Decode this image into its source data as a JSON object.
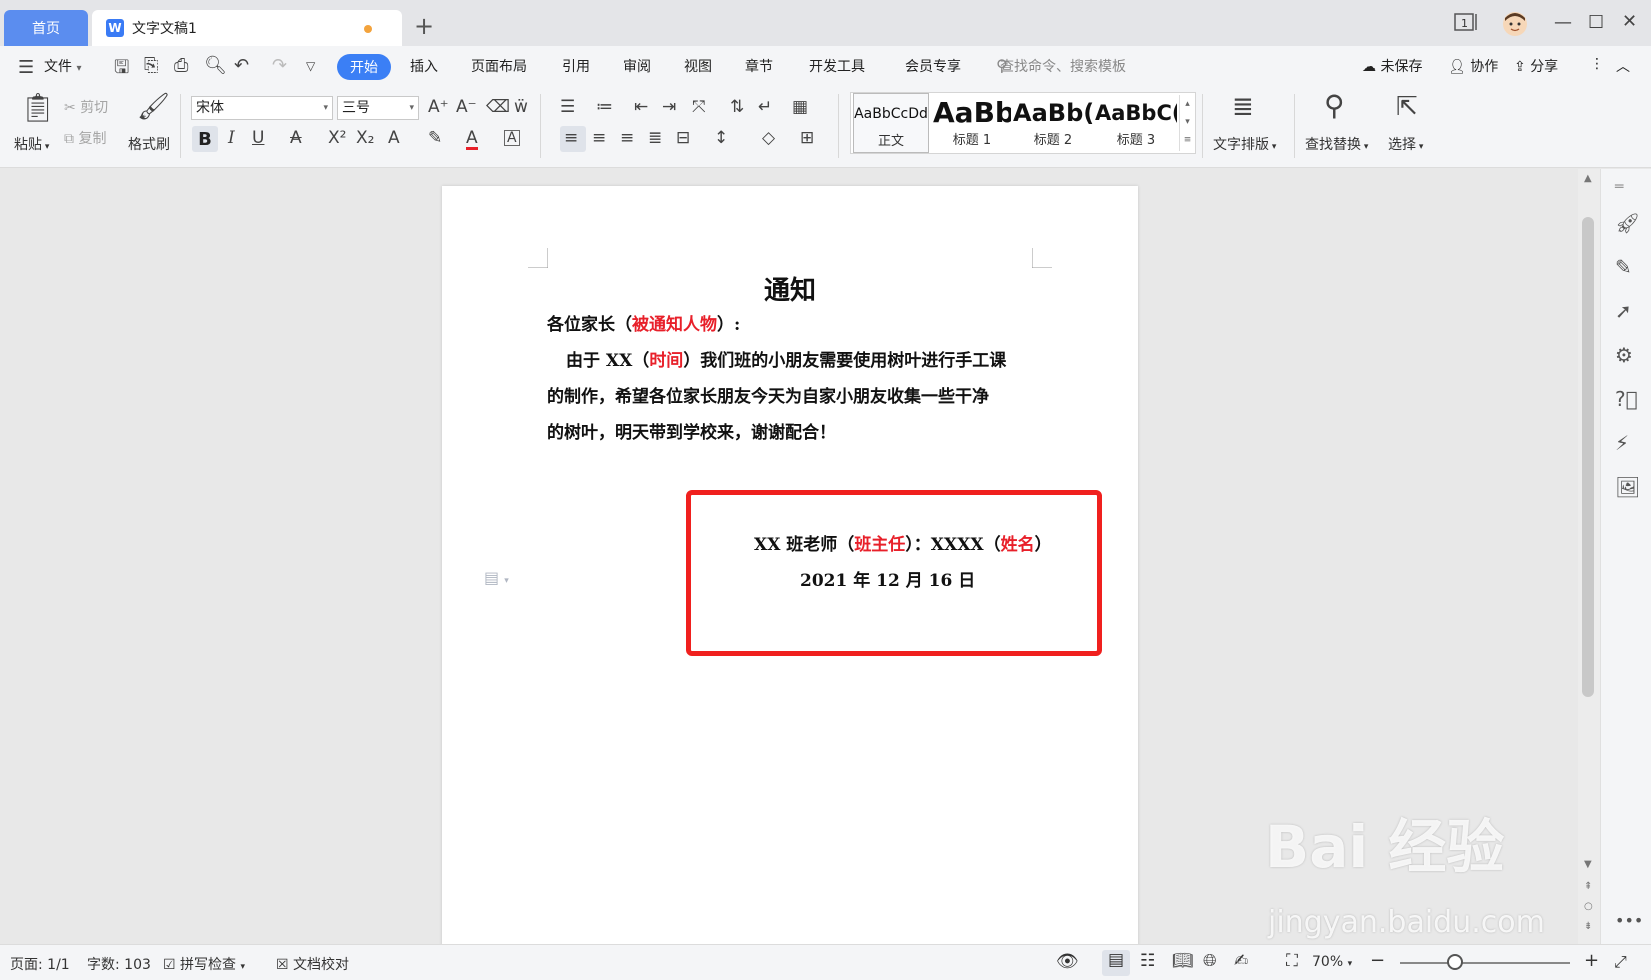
{
  "titlebar": {
    "home_tab": "首页",
    "doc_tab": "文字文稿1",
    "doc_icon": "W",
    "new_tab": "+",
    "page_badge": "1"
  },
  "menu": {
    "file": "文件",
    "items": [
      "开始",
      "插入",
      "页面布局",
      "引用",
      "审阅",
      "视图",
      "章节",
      "开发工具",
      "会员专享"
    ],
    "search_placeholder": "查找命令、搜索模板",
    "unsaved": "未保存",
    "collab": "协作",
    "share": "分享"
  },
  "ribbon": {
    "paste": "粘贴",
    "cut": "剪切",
    "copy": "复制",
    "format_painter": "格式刷",
    "font_name": "宋体",
    "font_size": "三号",
    "styles": [
      {
        "sample": "AaBbCcDd",
        "label": "正文"
      },
      {
        "sample": "AaBb",
        "label": "标题 1"
      },
      {
        "sample": "AaBb(",
        "label": "标题 2"
      },
      {
        "sample": "AaBbC(",
        "label": "标题 3"
      }
    ],
    "text_layout": "文字排版",
    "find_replace": "查找替换",
    "select": "选择"
  },
  "document": {
    "title": "通知",
    "salutation_pre": "各位家长（",
    "salutation_red": "被通知人物",
    "salutation_post": "）:",
    "body1_pre": "由于 XX（",
    "body1_red": "时间",
    "body1_post": "）我们班的小朋友需要使用树叶进行手工课",
    "body2": "的制作，希望各位家长朋友今天为自家小朋友收集一些干净",
    "body3": "的树叶，明天带到学校来，谢谢配合！",
    "sig_pre": "XX 班老师（",
    "sig_red1": "班主任",
    "sig_mid": "）：XXXX（",
    "sig_red2": "姓名",
    "sig_post": "）",
    "date": "2021 年 12 月 16 日"
  },
  "status": {
    "page": "页面: 1/1",
    "word_count": "字数: 103",
    "spell_check": "拼写检查",
    "proofread": "文档校对",
    "zoom": "70%"
  },
  "watermark": {
    "main": "Bai 经验",
    "url": "jingyan.baidu.com"
  },
  "colors": {
    "accent": "#3b7ff5",
    "highlight_box": "#f0201e",
    "red_text": "#e8202a"
  }
}
